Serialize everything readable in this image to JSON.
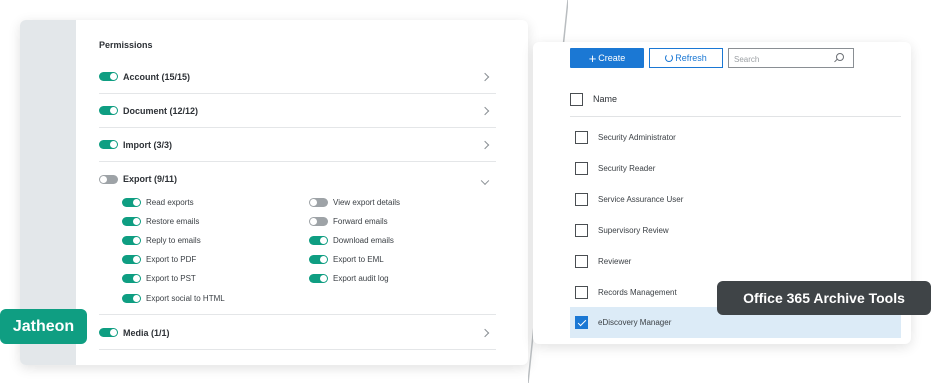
{
  "jatheon": {
    "badge": "Jatheon",
    "permissions_title": "Permissions",
    "categories": [
      {
        "label": "Account (15/15)",
        "on": true,
        "expanded": false
      },
      {
        "label": "Document (12/12)",
        "on": true,
        "expanded": false
      },
      {
        "label": "Import (3/3)",
        "on": true,
        "expanded": false
      },
      {
        "label": "Export (9/11)",
        "on": false,
        "expanded": true
      },
      {
        "label": "Media (1/1)",
        "on": true,
        "expanded": false
      }
    ],
    "export_items_left": [
      {
        "label": "Read exports",
        "on": true
      },
      {
        "label": "Restore emails",
        "on": true
      },
      {
        "label": "Reply to emails",
        "on": true
      },
      {
        "label": "Export to PDF",
        "on": true
      },
      {
        "label": "Export to PST",
        "on": true
      },
      {
        "label": "Export social to HTML",
        "on": true
      }
    ],
    "export_items_right": [
      {
        "label": "View export details",
        "on": false
      },
      {
        "label": "Forward emails",
        "on": false
      },
      {
        "label": "Download emails",
        "on": true
      },
      {
        "label": "Export to EML",
        "on": true
      },
      {
        "label": "Export audit log",
        "on": true
      }
    ]
  },
  "office365": {
    "badge": "Office 365 Archive Tools",
    "toolbar": {
      "create_label": "Create",
      "refresh_label": "Refresh",
      "search_placeholder": "Search"
    },
    "column_header": "Name",
    "roles": [
      {
        "label": "Security Administrator",
        "checked": false
      },
      {
        "label": "Security Reader",
        "checked": false
      },
      {
        "label": "Service Assurance User",
        "checked": false
      },
      {
        "label": "Supervisory Review",
        "checked": false
      },
      {
        "label": "Reviewer",
        "checked": false
      },
      {
        "label": "Records Management",
        "checked": false
      },
      {
        "label": "eDiscovery Manager",
        "checked": true
      }
    ]
  },
  "colors": {
    "jatheon_green": "#0f9e82",
    "toggle_off": "#9ea3a7",
    "office_blue": "#1b78d4",
    "selected_row": "#dcebf7",
    "o365_badge_bg": "#3f4447"
  }
}
